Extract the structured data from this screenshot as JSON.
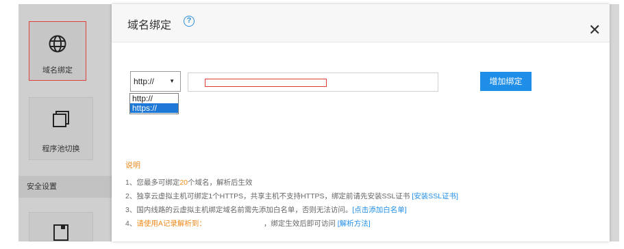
{
  "sidebar": {
    "tiles": [
      {
        "label": "域名绑定",
        "icon": "globe-icon"
      },
      {
        "label": "程序池切换",
        "icon": "window-stack-icon"
      }
    ],
    "section_title": "安全设置",
    "bottom_tile": {
      "icon": "document-icon"
    }
  },
  "modal": {
    "title": "域名绑定",
    "help": "?",
    "close": "✕",
    "protocol": {
      "selected": "http://",
      "arrow": "▼",
      "options": [
        "http://",
        "https://"
      ],
      "highlighted": "https://"
    },
    "domain_input": {
      "value": ""
    },
    "add_button": "增加绑定"
  },
  "notes": {
    "title": "说明",
    "line1": {
      "prefix": "1、您最多可绑定",
      "count": "20",
      "suffix": "个域名，解析后生效"
    },
    "line2": {
      "text": "2、独享云虚拟主机可绑定1个HTTPS，共享主机不支持HTTPS，绑定前请先安装SSL证书 ",
      "link": "[安装SSL证书]"
    },
    "line3": {
      "text": "3、国内线路的云虚拟主机绑定域名前需先添加白名单，否则无法访问。",
      "link": "[点击添加白名单]"
    },
    "line4": {
      "prefix": "4、",
      "warn": "请使用A记录解析到：",
      "suffix": "，绑定生效后即可访问 ",
      "link": "[解析方法]"
    }
  },
  "colors": {
    "accent": "#1f8ee8",
    "warn": "#f08a1b",
    "highlight": "#e03a35"
  }
}
